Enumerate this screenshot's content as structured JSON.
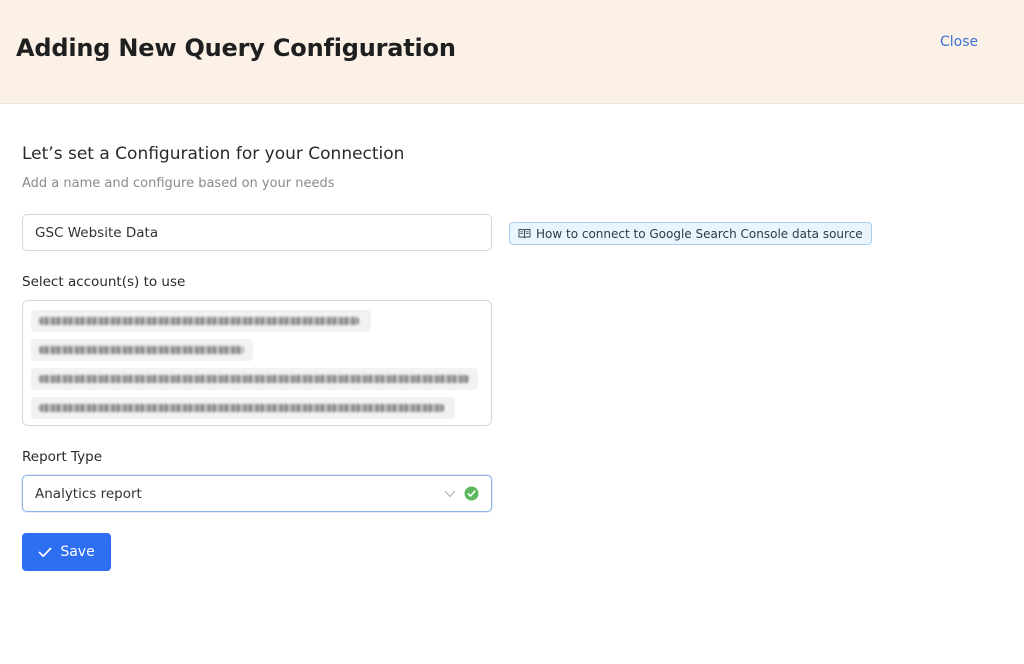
{
  "header": {
    "title": "Adding New Query Configuration",
    "close_label": "Close"
  },
  "form": {
    "heading": "Let’s set a Configuration for your Connection",
    "subheading": "Add a name and configure based on your needs",
    "name_value": "GSC Website Data",
    "help_link": "How to connect to Google Search Console data source",
    "accounts_label": "Select account(s) to use",
    "accounts_redacted": true,
    "report_type_label": "Report Type",
    "report_type_value": "Analytics report",
    "save_label": "Save"
  },
  "colors": {
    "header_bg": "#fbf1e7",
    "accent_blue": "#2e6ff2",
    "link_blue": "#3a72d8",
    "success_green": "#5cb85c"
  },
  "icons": {
    "help": "book-icon",
    "dropdown": "chevron-down-icon",
    "status": "check-circle-icon",
    "save": "checkmark-icon"
  }
}
